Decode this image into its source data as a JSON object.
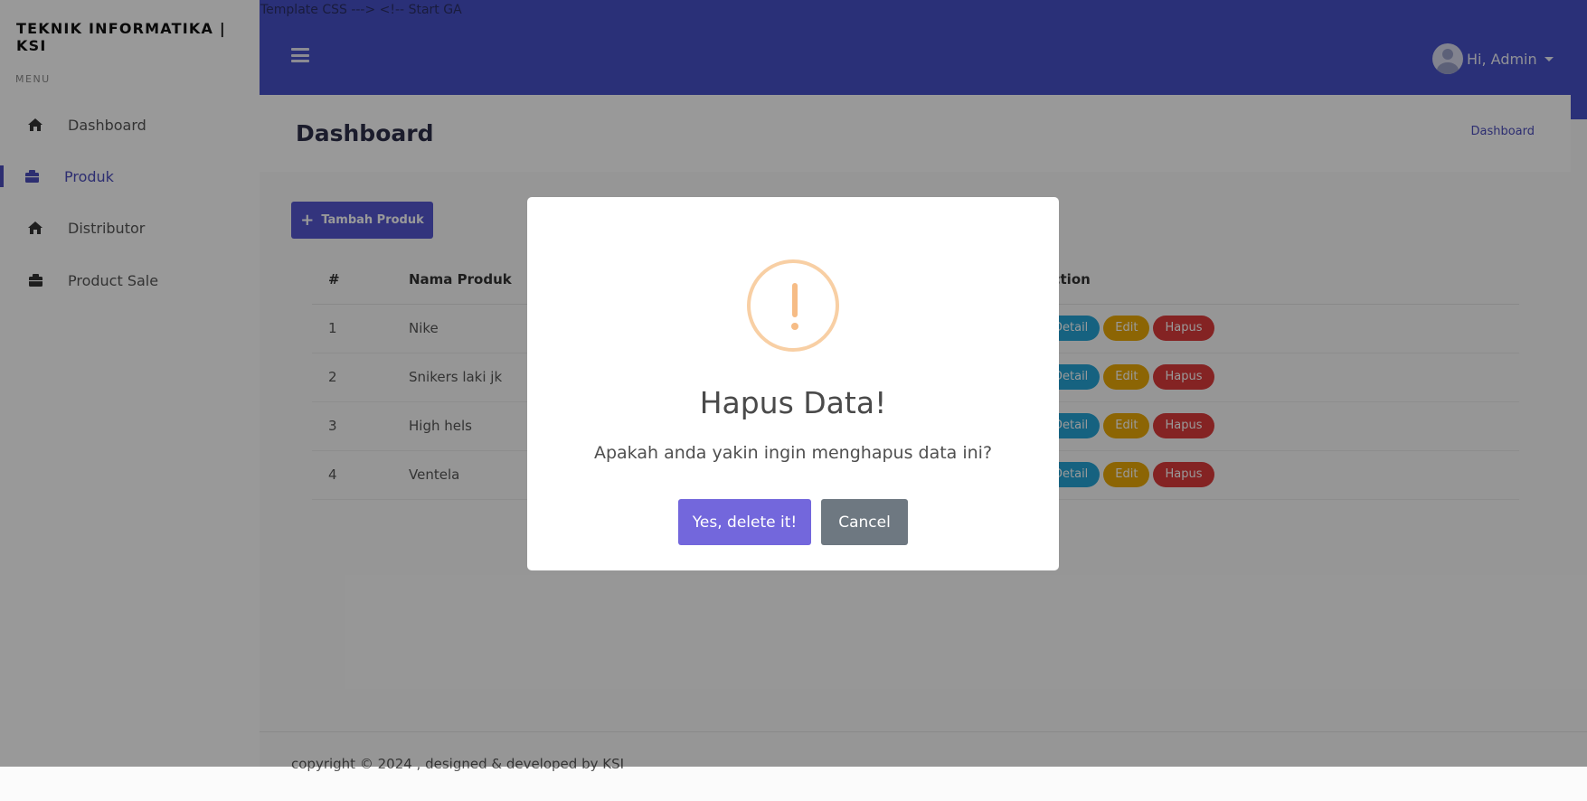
{
  "brand": "TEKNIK INFORMATIKA | KSI",
  "sidebar": {
    "menu_label": "MENU",
    "items": [
      {
        "label": "Dashboard",
        "icon": "home-icon",
        "active": false
      },
      {
        "label": "Produk",
        "icon": "box-icon",
        "active": true
      },
      {
        "label": "Distributor",
        "icon": "home-icon",
        "active": false
      },
      {
        "label": "Product Sale",
        "icon": "box-icon",
        "active": false
      }
    ]
  },
  "topbar": {
    "leaked_text": "Template CSS ---> <!-- Start GA",
    "user_greeting": "Hi, Admin"
  },
  "header": {
    "title": "Dashboard",
    "breadcrumb": "Dashboard"
  },
  "content": {
    "add_button": "Tambah Produk",
    "table": {
      "columns": [
        "#",
        "Nama Produk",
        "Action"
      ],
      "rows": [
        {
          "no": "1",
          "name": "Nike"
        },
        {
          "no": "2",
          "name": "Snikers laki jk"
        },
        {
          "no": "3",
          "name": "High hels"
        },
        {
          "no": "4",
          "name": "Ventela"
        }
      ],
      "actions": {
        "detail": "Detail",
        "edit": "Edit",
        "delete": "Hapus"
      }
    }
  },
  "footer": "copyright © 2024 , designed & developed by KSI",
  "modal": {
    "icon": "warning-icon",
    "title": "Hapus Data!",
    "text": "Apakah anda yakin ingin menghapus data ini?",
    "confirm_label": "Yes, delete it!",
    "cancel_label": "Cancel"
  },
  "colors": {
    "primary": "#4750c8",
    "danger": "#dd3b3b",
    "warning": "#e9a908",
    "info": "#25a4d6",
    "confirm": "#7367dc",
    "cancel": "#6e7881"
  }
}
